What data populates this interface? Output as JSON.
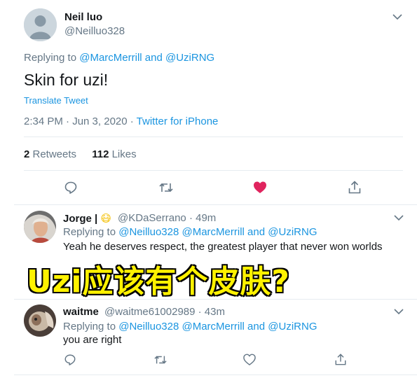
{
  "tweet": {
    "author_name": "Neil luo",
    "author_handle": "@Neilluo328",
    "replying_prefix": "Replying to ",
    "replying_user1": "@MarcMerrill",
    "replying_and": " and ",
    "replying_user2": "@UziRNG",
    "text": "Skin for uzi!",
    "translate_label": "Translate Tweet",
    "timestamp": "2:34 PM · Jun 3, 2020 · ",
    "source": "Twitter for iPhone",
    "retweets_count": "2",
    "retweets_label": " Retweets",
    "likes_count": "112",
    "likes_label": " Likes"
  },
  "replies": [
    {
      "name": "Jorge |",
      "emoji": "😷",
      "handle_time": "@KDaSerrano · 49m",
      "replying_prefix": "Replying to ",
      "replying_users": "@Neilluo328 @MarcMerrill",
      "replying_and": " and ",
      "replying_last": "@UziRNG",
      "text": "Yeah he deserves respect, the greatest player that never won worlds"
    },
    {
      "name": "waitme",
      "handle_time": "@waitme61002989 · 43m",
      "replying_prefix": "Replying to ",
      "replying_users": "@Neilluo328 @MarcMerrill",
      "replying_and": " and ",
      "replying_last": "@UziRNG",
      "text": "you are right"
    }
  ],
  "overlay_caption": "Uzi应该有个皮肤?",
  "colors": {
    "link": "#1b95e0",
    "secondary_text": "#657786",
    "like_active": "#e0245e",
    "overlay_fill": "#fff200"
  },
  "icons": [
    "reply-icon",
    "retweet-icon",
    "like-icon",
    "share-icon",
    "chevron-down-icon"
  ]
}
